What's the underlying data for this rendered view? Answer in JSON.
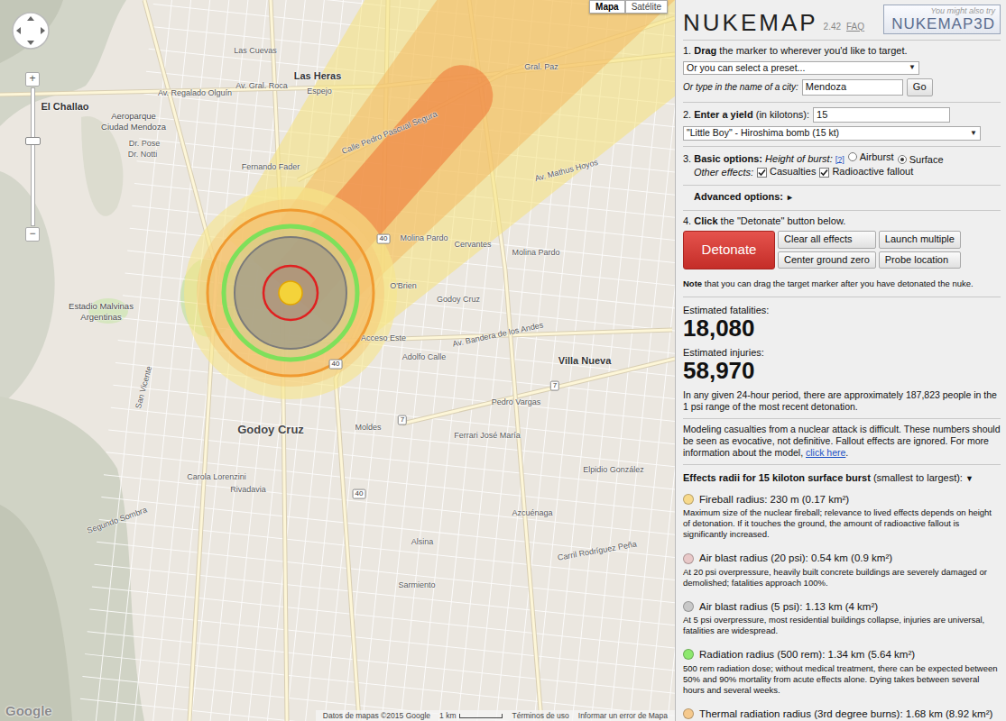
{
  "map": {
    "type_buttons": [
      {
        "label": "Mapa",
        "selected": true
      },
      {
        "label": "Satélite",
        "selected": false
      }
    ],
    "zoom": {
      "plus": "+",
      "minus": "−",
      "level": 0.62
    },
    "labels": [
      {
        "text": "Las Cuevas",
        "kind": "street"
      },
      {
        "text": "El Challao",
        "kind": "place"
      },
      {
        "text": "Las Heras",
        "kind": "place"
      },
      {
        "text": "Av. Regalado Olguín",
        "kind": "street"
      },
      {
        "text": "Av. Gral. Roca",
        "kind": "street"
      },
      {
        "text": "Espejo",
        "kind": "street"
      },
      {
        "text": "Aeroparque",
        "kind": "small"
      },
      {
        "text": "Ciudad Mendoza",
        "kind": "small"
      },
      {
        "text": "Dr. Pose",
        "kind": "street"
      },
      {
        "text": "Dr. Notti",
        "kind": "street"
      },
      {
        "text": "Fernando Fader",
        "kind": "street"
      },
      {
        "text": "Calle Pedro Pascual Segura",
        "kind": "street"
      },
      {
        "text": "Gral. Paz",
        "kind": "street"
      },
      {
        "text": "Av. Mathus Hoyos",
        "kind": "street"
      },
      {
        "text": "Molina Pardo",
        "kind": "street"
      },
      {
        "text": "Cervantes",
        "kind": "street"
      },
      {
        "text": "Molina Pardo",
        "kind": "street"
      },
      {
        "text": "Estadio Malvinas",
        "kind": "small"
      },
      {
        "text": "Argentinas",
        "kind": "small"
      },
      {
        "text": "O'Brien",
        "kind": "street"
      },
      {
        "text": "Godoy Cruz",
        "kind": "street"
      },
      {
        "text": "Acceso Este",
        "kind": "street"
      },
      {
        "text": "Adolfo Calle",
        "kind": "street"
      },
      {
        "text": "Av. Bandera de los Andes",
        "kind": "street"
      },
      {
        "text": "Villa Nueva",
        "kind": "place"
      },
      {
        "text": "Godoy Cruz",
        "kind": "big"
      },
      {
        "text": "Moldes",
        "kind": "street"
      },
      {
        "text": "Pedro Vargas",
        "kind": "street"
      },
      {
        "text": "Ferrari José María",
        "kind": "street"
      },
      {
        "text": "Elpidio González",
        "kind": "street"
      },
      {
        "text": "Carril Rodríguez Peña",
        "kind": "street"
      },
      {
        "text": "Alsina",
        "kind": "street"
      },
      {
        "text": "Sarmiento",
        "kind": "street"
      },
      {
        "text": "Carola Lorenzini",
        "kind": "street"
      },
      {
        "text": "Rivadavia",
        "kind": "street"
      },
      {
        "text": "San Vicente",
        "kind": "street"
      },
      {
        "text": "Segundo Sombra",
        "kind": "street"
      },
      {
        "text": "Azcuénaga",
        "kind": "street"
      },
      {
        "text": "40",
        "kind": "shield"
      },
      {
        "text": "40",
        "kind": "shield"
      },
      {
        "text": "40",
        "kind": "shield"
      },
      {
        "text": "7",
        "kind": "shield"
      },
      {
        "text": "7",
        "kind": "shield"
      }
    ],
    "logo": "Google",
    "attribution": {
      "data": "Datos de mapas ©2015 Google",
      "scale": "1 km",
      "terms": "Términos de uso",
      "report": "Informar un error de Mapa"
    }
  },
  "sidebar": {
    "header": {
      "title": "NUKEMAP",
      "version": "2.42",
      "faq": "FAQ",
      "promo_small": "You might also try",
      "promo_big": "NUKEMAP3D"
    },
    "step1": {
      "parts": [
        {
          "t": "1. ",
          "bold": false
        },
        {
          "t": "Drag",
          "bold": true
        },
        {
          "t": " the marker to wherever you'd like to target.",
          "bold": false
        }
      ],
      "preset": {
        "value": "Or you can select a preset...",
        "arrow": "▼"
      },
      "city_label": "Or type in the name of a city:",
      "city_value": "Mendoza",
      "go": "Go"
    },
    "step2": {
      "parts": [
        {
          "t": "2. ",
          "bold": false
        },
        {
          "t": "Enter a yield",
          "bold": true
        },
        {
          "t": " (in kilotons):",
          "bold": false
        }
      ],
      "yield_value": "15",
      "bomb": {
        "value": "\"Little Boy\" - Hiroshima bomb (15 kt)",
        "arrow": "▼"
      }
    },
    "step3": {
      "parts": [
        {
          "t": "3. ",
          "bold": false
        },
        {
          "t": "Basic options:",
          "bold": true
        }
      ],
      "hob_label": "Height of burst:",
      "help": "[?]",
      "hob": [
        {
          "label": "Airburst",
          "selected": false
        },
        {
          "label": "Surface",
          "selected": true
        }
      ],
      "other_label": "Other effects:",
      "effects": [
        {
          "label": "Casualties",
          "checked": true
        },
        {
          "label": "Radioactive fallout",
          "checked": true
        }
      ]
    },
    "advanced": {
      "label": "Advanced options:",
      "arrow": "►",
      "expanded": false
    },
    "step4": {
      "parts": [
        {
          "t": "4. ",
          "bold": false
        },
        {
          "t": "Click",
          "bold": true
        },
        {
          "t": " the \"Detonate\" button below.",
          "bold": false
        }
      ]
    },
    "detonate": "Detonate",
    "buttons": [
      "Clear all effects",
      "Launch multiple",
      "Center ground zero",
      "Probe location"
    ],
    "note": {
      "bold": "Note",
      "rest": " that you can drag the target marker after you have detonated the nuke."
    },
    "fatalities": {
      "label": "Estimated fatalities:",
      "value": "18,080"
    },
    "injuries": {
      "label": "Estimated injuries:",
      "value": "58,970"
    },
    "population": "In any given 24-hour period, there are approximately 187,823 people in the 1 psi range of the most recent detonation.",
    "model": {
      "text": "Modeling casualties from a nuclear attack is difficult. These numbers should be seen as evocative, not definitive. Fallout effects are ignored. For more information about the model, ",
      "link": "click here",
      "end": "."
    },
    "effects_header": {
      "bold": "Effects radii for 15 kiloton surface burst",
      "rest": " (smallest to largest):",
      "arrow": "▼"
    },
    "effects": [
      {
        "title": "Fireball radius: 230 m (0.17 km²)",
        "desc": "Maximum size of the nuclear fireball; relevance to lived effects depends on height of detonation. If it touches the ground, the amount of radioactive fallout is significantly increased.",
        "color": "#f7d98b"
      },
      {
        "title": "Air blast radius (20 psi): 0.54 km (0.9 km²)",
        "desc": "At 20 psi overpressure, heavily built concrete buildings are severely damaged or demolished; fatalities approach 100%.",
        "color": "#e8c8c8"
      },
      {
        "title": "Air blast radius (5 psi): 1.13 km (4 km²)",
        "desc": "At 5 psi overpressure, most residential buildings collapse, injuries are universal, fatalities are widespread.",
        "color": "#c8c8c8"
      },
      {
        "title": "Radiation radius (500 rem): 1.34 km (5.64 km²)",
        "desc": "500 rem radiation dose; without medical treatment, there can be expected between 50% and 90% mortality from acute effects alone. Dying takes between several hours and several weeks.",
        "color": "#8de86e"
      },
      {
        "title": "Thermal radiation radius (3rd degree burns): 1.68 km (8.92 km²)",
        "desc": "",
        "color": "#f5c98d"
      }
    ]
  }
}
